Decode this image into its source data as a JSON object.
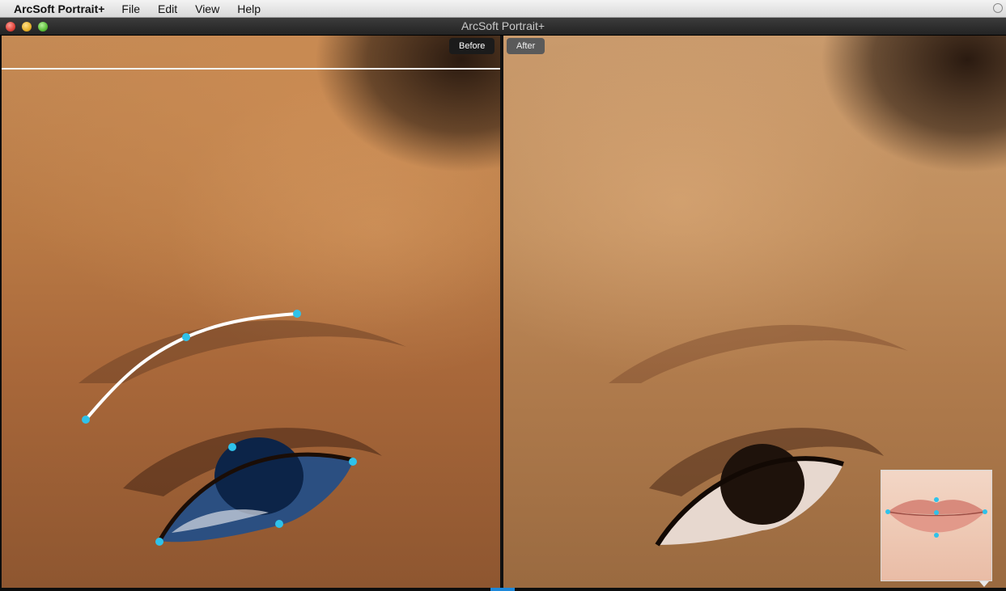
{
  "menubar": {
    "app_name": "ArcSoft Portrait+",
    "menus": [
      "File",
      "Edit",
      "View",
      "Help"
    ]
  },
  "window": {
    "title": "ArcSoft Portrait+"
  },
  "panels": {
    "before_label": "Before",
    "after_label": "After"
  },
  "colors": {
    "control_point": "#2fc2ea",
    "eye_overlay": "#1f4e8a",
    "curve": "#ffffff"
  },
  "thumbnail": {
    "subject": "lips"
  }
}
